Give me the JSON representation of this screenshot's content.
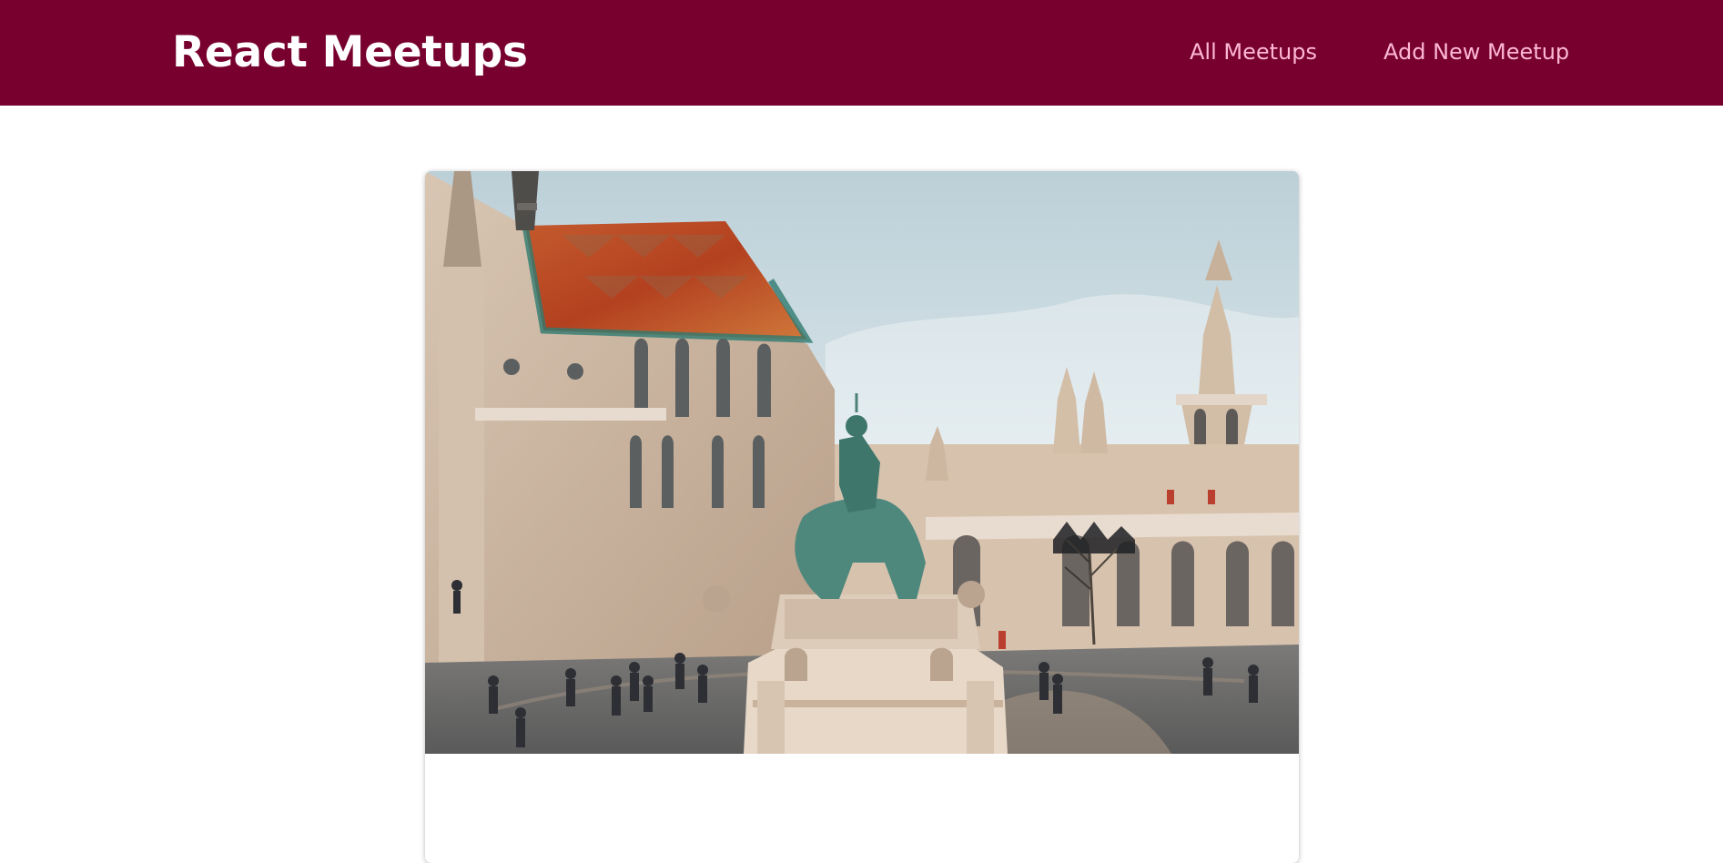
{
  "header": {
    "logo_text": "React Meetups",
    "brand_color": "#77002e",
    "nav_link_color": "#fcb8d2"
  },
  "nav": {
    "items": [
      {
        "label": "All Meetups"
      },
      {
        "label": "Add New Meetup"
      }
    ]
  },
  "meetup": {
    "image_subject": "Matthias Church and Fisherman's Bastion with equestrian statue, Budapest",
    "title": ""
  }
}
